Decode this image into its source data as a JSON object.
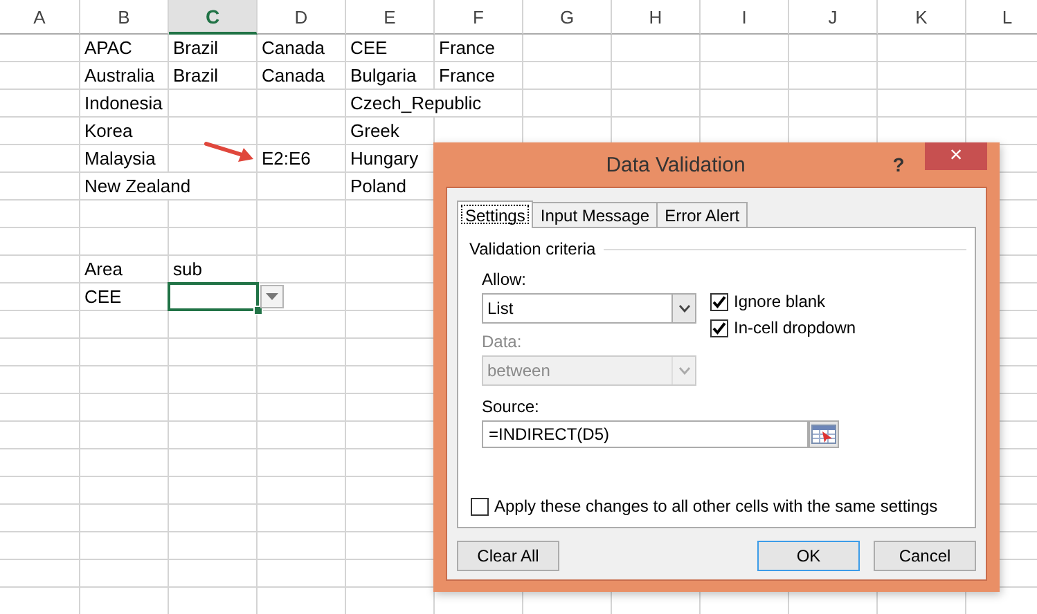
{
  "sheet": {
    "columns": [
      {
        "label": "A",
        "selected": false
      },
      {
        "label": "B",
        "selected": false
      },
      {
        "label": "C",
        "selected": true
      },
      {
        "label": "D",
        "selected": false
      },
      {
        "label": "E",
        "selected": false
      },
      {
        "label": "F",
        "selected": false
      },
      {
        "label": "G",
        "selected": false
      },
      {
        "label": "H",
        "selected": false
      },
      {
        "label": "I",
        "selected": false
      },
      {
        "label": "J",
        "selected": false
      },
      {
        "label": "K",
        "selected": false
      },
      {
        "label": "L",
        "selected": false
      }
    ],
    "rows": [
      {
        "cells": [
          "",
          "APAC",
          "Brazil",
          "Canada",
          "CEE",
          "France"
        ]
      },
      {
        "cells": [
          "",
          "Australia",
          "Brazil",
          "Canada",
          "Bulgaria",
          "France"
        ]
      },
      {
        "cells": [
          "",
          "Indonesia",
          "",
          "",
          "Czech_Republic"
        ]
      },
      {
        "cells": [
          "",
          "Korea",
          "",
          "",
          "Greek"
        ]
      },
      {
        "cells": [
          "",
          "Malaysia",
          "",
          "E2:E6",
          "Hungary"
        ]
      },
      {
        "cells": [
          "",
          "New Zealand",
          "",
          "",
          "Poland"
        ]
      },
      {
        "cells": []
      },
      {
        "cells": []
      },
      {
        "cells": [
          "",
          "Area",
          "sub"
        ]
      },
      {
        "cells": [
          "",
          "CEE",
          {
            "selected": true,
            "dropdown": true
          }
        ]
      }
    ]
  },
  "dialog": {
    "title": "Data Validation",
    "help": "?",
    "close": "×",
    "tabs": [
      {
        "label": "Settings",
        "selected": true
      },
      {
        "label": "Input Message",
        "selected": false
      },
      {
        "label": "Error Alert",
        "selected": false
      }
    ],
    "group": "Validation criteria",
    "allow": {
      "label": "Allow:",
      "value": "List",
      "disabled": false
    },
    "data": {
      "label": "Data:",
      "value": "between",
      "disabled": true
    },
    "checkboxes": [
      {
        "label": "Ignore blank",
        "checked": true
      },
      {
        "label": "In-cell dropdown",
        "checked": true
      }
    ],
    "source": {
      "label": "Source:",
      "value": "=INDIRECT(D5)"
    },
    "apply": {
      "label": "Apply these changes to all other cells with the same settings",
      "checked": false
    },
    "buttons": [
      {
        "label": "Clear All",
        "default": false
      },
      {
        "label": "OK",
        "default": true
      },
      {
        "label": "Cancel",
        "default": false
      }
    ]
  }
}
